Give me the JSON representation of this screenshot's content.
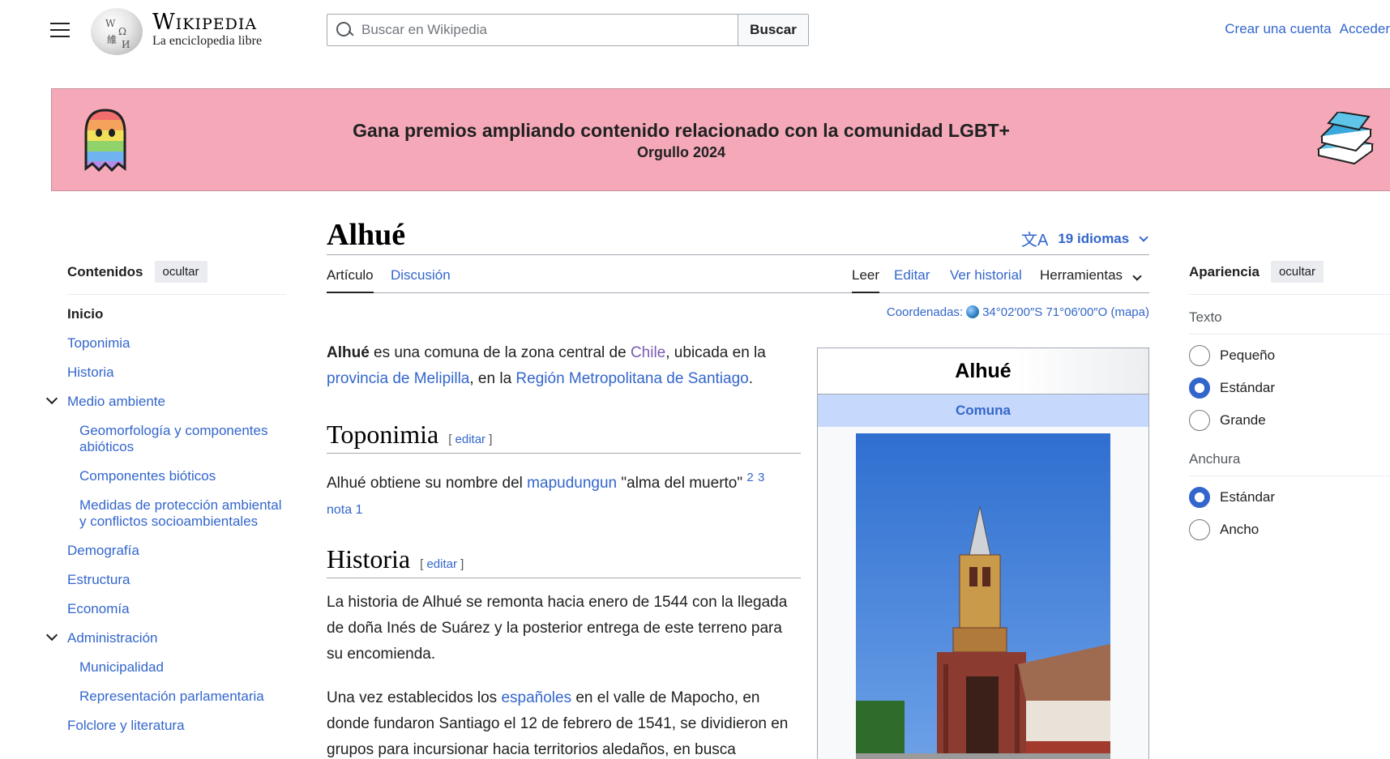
{
  "header": {
    "wordmark": "Wikipedia",
    "tagline": "La enciclopedia libre",
    "search_placeholder": "Buscar en Wikipedia",
    "search_button": "Buscar",
    "create_account": "Crear una cuenta",
    "login": "Acceder"
  },
  "banner": {
    "title": "Gana premios ampliando contenido relacionado con la comunidad LGBT+",
    "subtitle": "Orgullo 2024"
  },
  "toc": {
    "heading": "Contenidos",
    "hide": "ocultar",
    "items": [
      {
        "label": "Inicio"
      },
      {
        "label": "Toponimia"
      },
      {
        "label": "Historia"
      },
      {
        "label": "Medio ambiente"
      },
      {
        "label": "Geomorfología y componentes abióticos"
      },
      {
        "label": "Componentes bióticos"
      },
      {
        "label": "Medidas de protección ambiental y conflictos socioambientales"
      },
      {
        "label": "Demografía"
      },
      {
        "label": "Estructura"
      },
      {
        "label": "Economía"
      },
      {
        "label": "Administración"
      },
      {
        "label": "Municipalidad"
      },
      {
        "label": "Representación parlamentaria"
      },
      {
        "label": "Folclore y literatura"
      }
    ]
  },
  "article": {
    "title": "Alhué",
    "languages": "19 idiomas",
    "tabs": {
      "article": "Artículo",
      "talk": "Discusión",
      "read": "Leer",
      "edit": "Editar",
      "history": "Ver historial",
      "tools": "Herramientas"
    },
    "coords_label": "Coordenadas:",
    "coords_value": "34°02′00″S 71°06′00″O",
    "coords_map": "mapa",
    "intro": {
      "bold": "Alhué",
      "t1": " es una comuna de la zona central de ",
      "chile": "Chile",
      "t2": ", ubicada en la ",
      "melipilla": "provincia de Melipilla",
      "t3": ", en la ",
      "region": "Región Metropolitana de Santiago",
      "t4": "."
    },
    "toponimia": {
      "heading": "Toponimia",
      "edit": "editar",
      "t1": "Alhué obtiene su nombre del ",
      "link": "mapudungun",
      "t2": " \"alma del muerto\" ",
      "ref2": "2",
      "ref3": "3",
      "nota": "nota 1"
    },
    "historia": {
      "heading": "Historia",
      "edit": "editar",
      "p1": "La historia de Alhué se remonta hacia enero de 1544 con la llegada de doña Inés de Suárez y la posterior entrega de este terreno para su encomienda.",
      "p2a": "Una vez establecidos los ",
      "p2link": "españoles",
      "p2b": " en el valle de Mapocho, en donde fundaron Santiago el 12 de febrero de 1541, se dividieron en grupos para incursionar hacia territorios aledaños, en busca"
    }
  },
  "infobox": {
    "title": "Alhué",
    "type": "Comuna"
  },
  "appearance": {
    "heading": "Apariencia",
    "hide": "ocultar",
    "text_label": "Texto",
    "text_options": [
      "Pequeño",
      "Estándar",
      "Grande"
    ],
    "width_label": "Anchura",
    "width_options": [
      "Estándar",
      "Ancho"
    ]
  }
}
